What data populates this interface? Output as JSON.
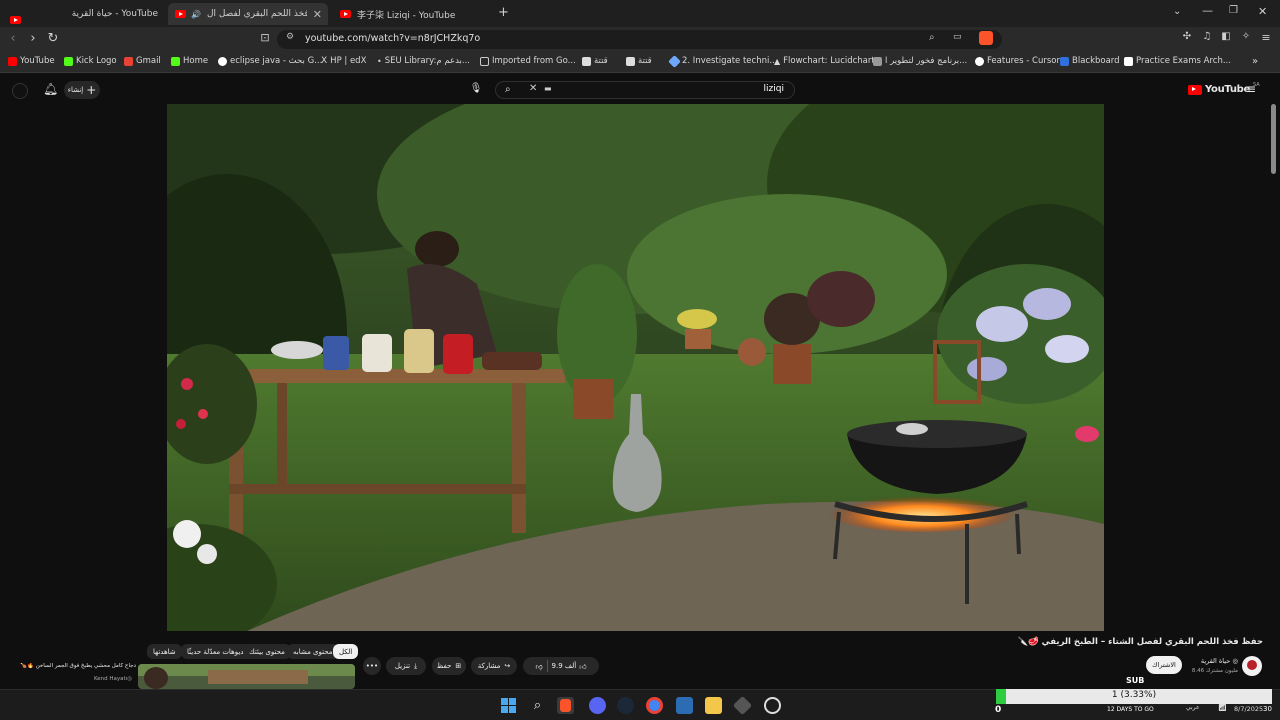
{
  "tabs": [
    {
      "title": "حياة القرية - YouTube",
      "active": false
    },
    {
      "title": "حفظ فخذ اللحم البقري لفصل ال...",
      "active": true
    },
    {
      "title": "李子柒 Liziqi - YouTube",
      "active": false
    }
  ],
  "new_tab_label": "+",
  "address": {
    "url": "youtube.com/watch?v=n8rJCHZkq7o"
  },
  "bookmarks": [
    {
      "label": "YouTube",
      "color": "#ff0000"
    },
    {
      "label": "Kick Logo",
      "color": "#53fc18"
    },
    {
      "label": "Gmail",
      "color": "#ea4335"
    },
    {
      "label": "Home",
      "color": "#53fc18"
    },
    {
      "label": "eclipse java - بحث G...",
      "color": "#ffffff"
    },
    {
      "label": "HP | edX",
      "color": "#ffffff"
    },
    {
      "label": "SEU Library:بدعم م...",
      "color": "#ffffff"
    },
    {
      "label": "Imported from Go...",
      "color": "#cccccc"
    },
    {
      "label": "قتتة",
      "color": "#dddddd"
    },
    {
      "label": "قتتة",
      "color": "#dddddd"
    },
    {
      "label": "2. Investigate techni...",
      "color": "#6ea8fe"
    },
    {
      "label": "Flowchart: Lucidchart",
      "color": "#f6a623"
    },
    {
      "label": "برنامج فخور لتطوير ا...",
      "color": "#cccccc"
    },
    {
      "label": "Features - Cursor",
      "color": "#ffffff"
    },
    {
      "label": "Blackboard",
      "color": "#2f6fde"
    },
    {
      "label": "Practice Exams Arch...",
      "color": "#ffffff"
    }
  ],
  "youtube": {
    "logo": "YouTube",
    "region": "SA",
    "search_value": "liziqi",
    "create_label": "إنشاء",
    "create_plus": "+"
  },
  "video": {
    "title": "حفظ فخذ اللحم البقري لفصل الشتاء – الطبخ الريفي 🥩🔪",
    "channel": "حياة القرية ◎",
    "subscribers": "8.46 مليون مشترك",
    "subscribe_label": "الاشتراك",
    "likes": "9.9 ألف",
    "share_label": "مشاركة",
    "save_label": "حفظ",
    "download_label": "تنزيل",
    "more_label": "•••"
  },
  "filter_chips": [
    {
      "label": "الكل",
      "selected": true
    },
    {
      "label": "محتوى مشابه",
      "selected": false
    },
    {
      "label": "محتوى بيئتك",
      "selected": false
    },
    {
      "label": "فيديوهات معدّلة حديثًا",
      "selected": false
    },
    {
      "label": "شاهدتها",
      "selected": false
    }
  ],
  "recommendation": {
    "title": "دجاج كامل محشي يطبخ فوق الجمر الساخن 🔥🍗",
    "channel": "Kend Hayatı◎"
  },
  "sub_widget": {
    "label": "SUB",
    "count": "1 (3.33%)",
    "left_value": "0",
    "right_value": "30",
    "days": "12 DAYS TO GO",
    "progress": 0.0333
  },
  "taskbar": {
    "date": "8/7/2025",
    "lang": "عربي"
  },
  "colors": {
    "accent": "#ff0000",
    "bg": "#0f0f0f",
    "progress_green": "#2ecc40"
  }
}
